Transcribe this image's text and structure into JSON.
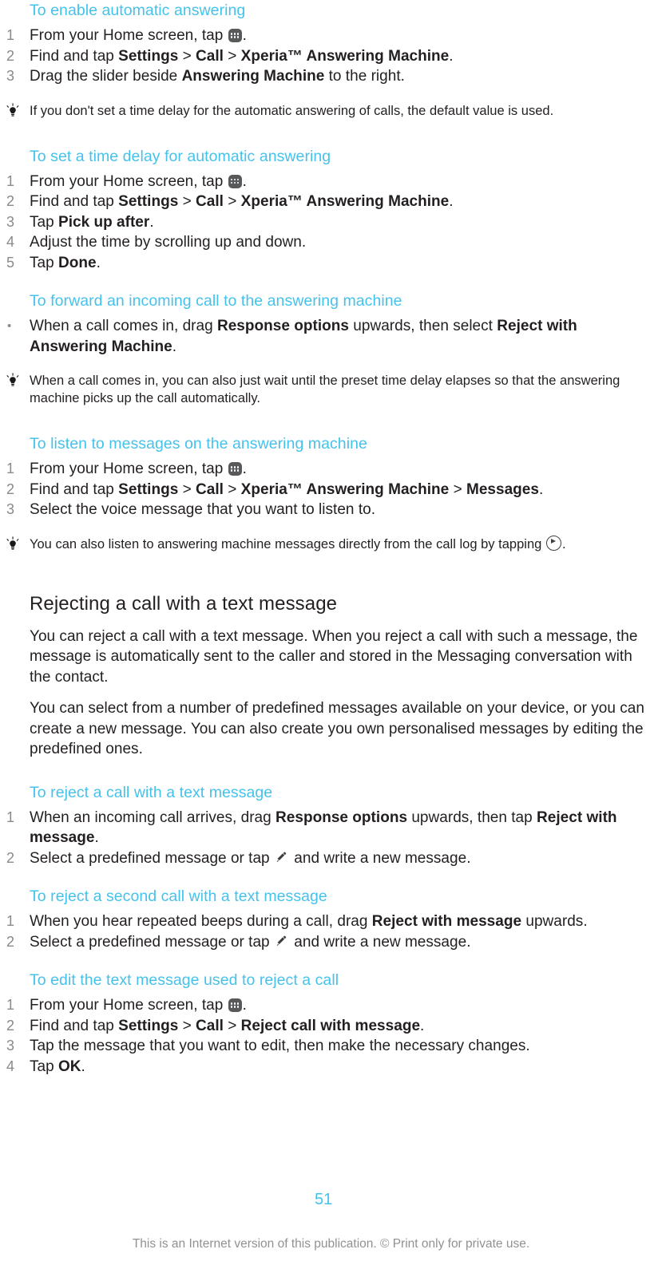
{
  "document": {
    "page_number": "51",
    "footer_note": "This is an Internet version of this publication. © Print only for private use.",
    "heading_color": "#45c2ec",
    "body_color": "#231f20",
    "number_color": "#8a8a8a",
    "footer_color": "#8f9193"
  },
  "sections": {
    "enable_auto_answering": {
      "heading": "To enable automatic answering",
      "steps": {
        "s1_a": "From your Home screen, tap",
        "s1_b": ".",
        "s2_a": "Find and tap ",
        "s2_settings": "Settings",
        "s2_sep1": " > ",
        "s2_call": "Call",
        "s2_sep2": " > ",
        "s2_xperia": "Xperia™ Answering Machine",
        "s2_end": ".",
        "s3_a": "Drag the slider beside ",
        "s3_bold": "Answering Machine",
        "s3_end": " to the right."
      },
      "tip": "If you don't set a time delay for the automatic answering of calls, the default value is used."
    },
    "time_delay": {
      "heading": "To set a time delay for automatic answering",
      "steps": {
        "s1_a": "From your Home screen, tap",
        "s1_b": ".",
        "s2_a": "Find and tap ",
        "s2_settings": "Settings",
        "s2_sep1": " > ",
        "s2_call": "Call",
        "s2_sep2": " > ",
        "s2_xperia": "Xperia™ Answering Machine",
        "s2_end": ".",
        "s3_a": "Tap ",
        "s3_bold": "Pick up after",
        "s3_end": ".",
        "s4": "Adjust the time by scrolling up and down.",
        "s5_a": "Tap ",
        "s5_bold": "Done",
        "s5_end": "."
      }
    },
    "forward_incoming": {
      "heading": "To forward an incoming call to the answering machine",
      "bullet": {
        "p1": "When a call comes in, drag ",
        "b1": "Response options",
        "p2": " upwards, then select ",
        "b2": "Reject with Answering Machine",
        "p3": "."
      },
      "tip": "When a call comes in, you can also just wait until the preset time delay elapses so that the answering machine picks up the call automatically."
    },
    "listen_messages": {
      "heading": "To listen to messages on the answering machine",
      "steps": {
        "s1_a": "From your Home screen, tap",
        "s1_b": ".",
        "s2_a": "Find and tap ",
        "s2_settings": "Settings",
        "s2_sep1": " > ",
        "s2_call": "Call",
        "s2_sep2": " > ",
        "s2_xperia": "Xperia™ Answering Machine",
        "s2_sep3": " > ",
        "s2_messages": "Messages",
        "s2_end": ".",
        "s3": "Select the voice message that you want to listen to."
      },
      "tip_a": "You can also listen to answering machine messages directly from the call log by tapping",
      "tip_b": "."
    },
    "rejecting_text": {
      "heading": "Rejecting a call with a text message",
      "para1": "You can reject a call with a text message. When you reject a call with such a message, the message is automatically sent to the caller and stored in the Messaging conversation with the contact.",
      "para2": "You can select from a number of predefined messages available on your device, or you can create a new message. You can also create you own personalised messages by editing the predefined ones."
    },
    "reject_with_text": {
      "heading": "To reject a call with a text message",
      "steps": {
        "s1_a": "When an incoming call arrives, drag ",
        "s1_b1": "Response options",
        "s1_mid": " upwards, then tap ",
        "s1_b2": "Reject with message",
        "s1_end": ".",
        "s2_a": "Select a predefined message or tap",
        "s2_b": "and write a new message."
      }
    },
    "reject_second_call": {
      "heading": "To reject a second call with a text message",
      "steps": {
        "s1_a": "When you hear repeated beeps during a call, drag ",
        "s1_b1": "Reject with message",
        "s1_end": " upwards.",
        "s2_a": "Select a predefined message or tap",
        "s2_b": "and write a new message."
      }
    },
    "edit_text_message": {
      "heading": "To edit the text message used to reject a call",
      "steps": {
        "s1_a": "From your Home screen, tap",
        "s1_b": ".",
        "s2_a": "Find and tap ",
        "s2_settings": "Settings",
        "s2_sep1": " > ",
        "s2_call": "Call",
        "s2_sep2": " > ",
        "s2_reject": "Reject call with message",
        "s2_end": ".",
        "s3": "Tap the message that you want to edit, then make the necessary changes.",
        "s4_a": "Tap ",
        "s4_bold": "OK",
        "s4_end": "."
      }
    }
  },
  "icons": {
    "apps_drawer": "apps-drawer-icon",
    "play_circle": "play-circle-icon",
    "pencil": "pencil-icon",
    "tip_bulb": "lightbulb-tip-icon"
  }
}
